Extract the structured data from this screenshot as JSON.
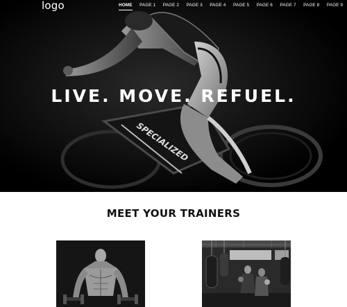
{
  "header": {
    "logo_text": "logo",
    "nav": [
      {
        "label": "HOME",
        "active": true
      },
      {
        "label": "PAGE 1"
      },
      {
        "label": "PAGE 2"
      },
      {
        "label": "PAGE 3"
      },
      {
        "label": "PAGE 4"
      },
      {
        "label": "PAGE 5"
      },
      {
        "label": "PAGE 6"
      },
      {
        "label": "PAGE 7"
      },
      {
        "label": "PAGE 8"
      },
      {
        "label": "PAGE 9"
      }
    ]
  },
  "hero": {
    "title": "LIVE. MOVE. REFUEL.",
    "image_icon": "cyclist-photo",
    "bike_brand": "SPECIALIZED"
  },
  "trainers": {
    "title": "MEET YOUR TRAINERS",
    "photos": [
      {
        "icon": "trainer-bodybuilder-photo"
      },
      {
        "icon": "trainer-boxing-gym-photo"
      }
    ]
  },
  "colors": {
    "hero_background": "#000000",
    "page_background": "#ffffff",
    "hero_text": "#ffffff",
    "heading_text": "#111111"
  }
}
